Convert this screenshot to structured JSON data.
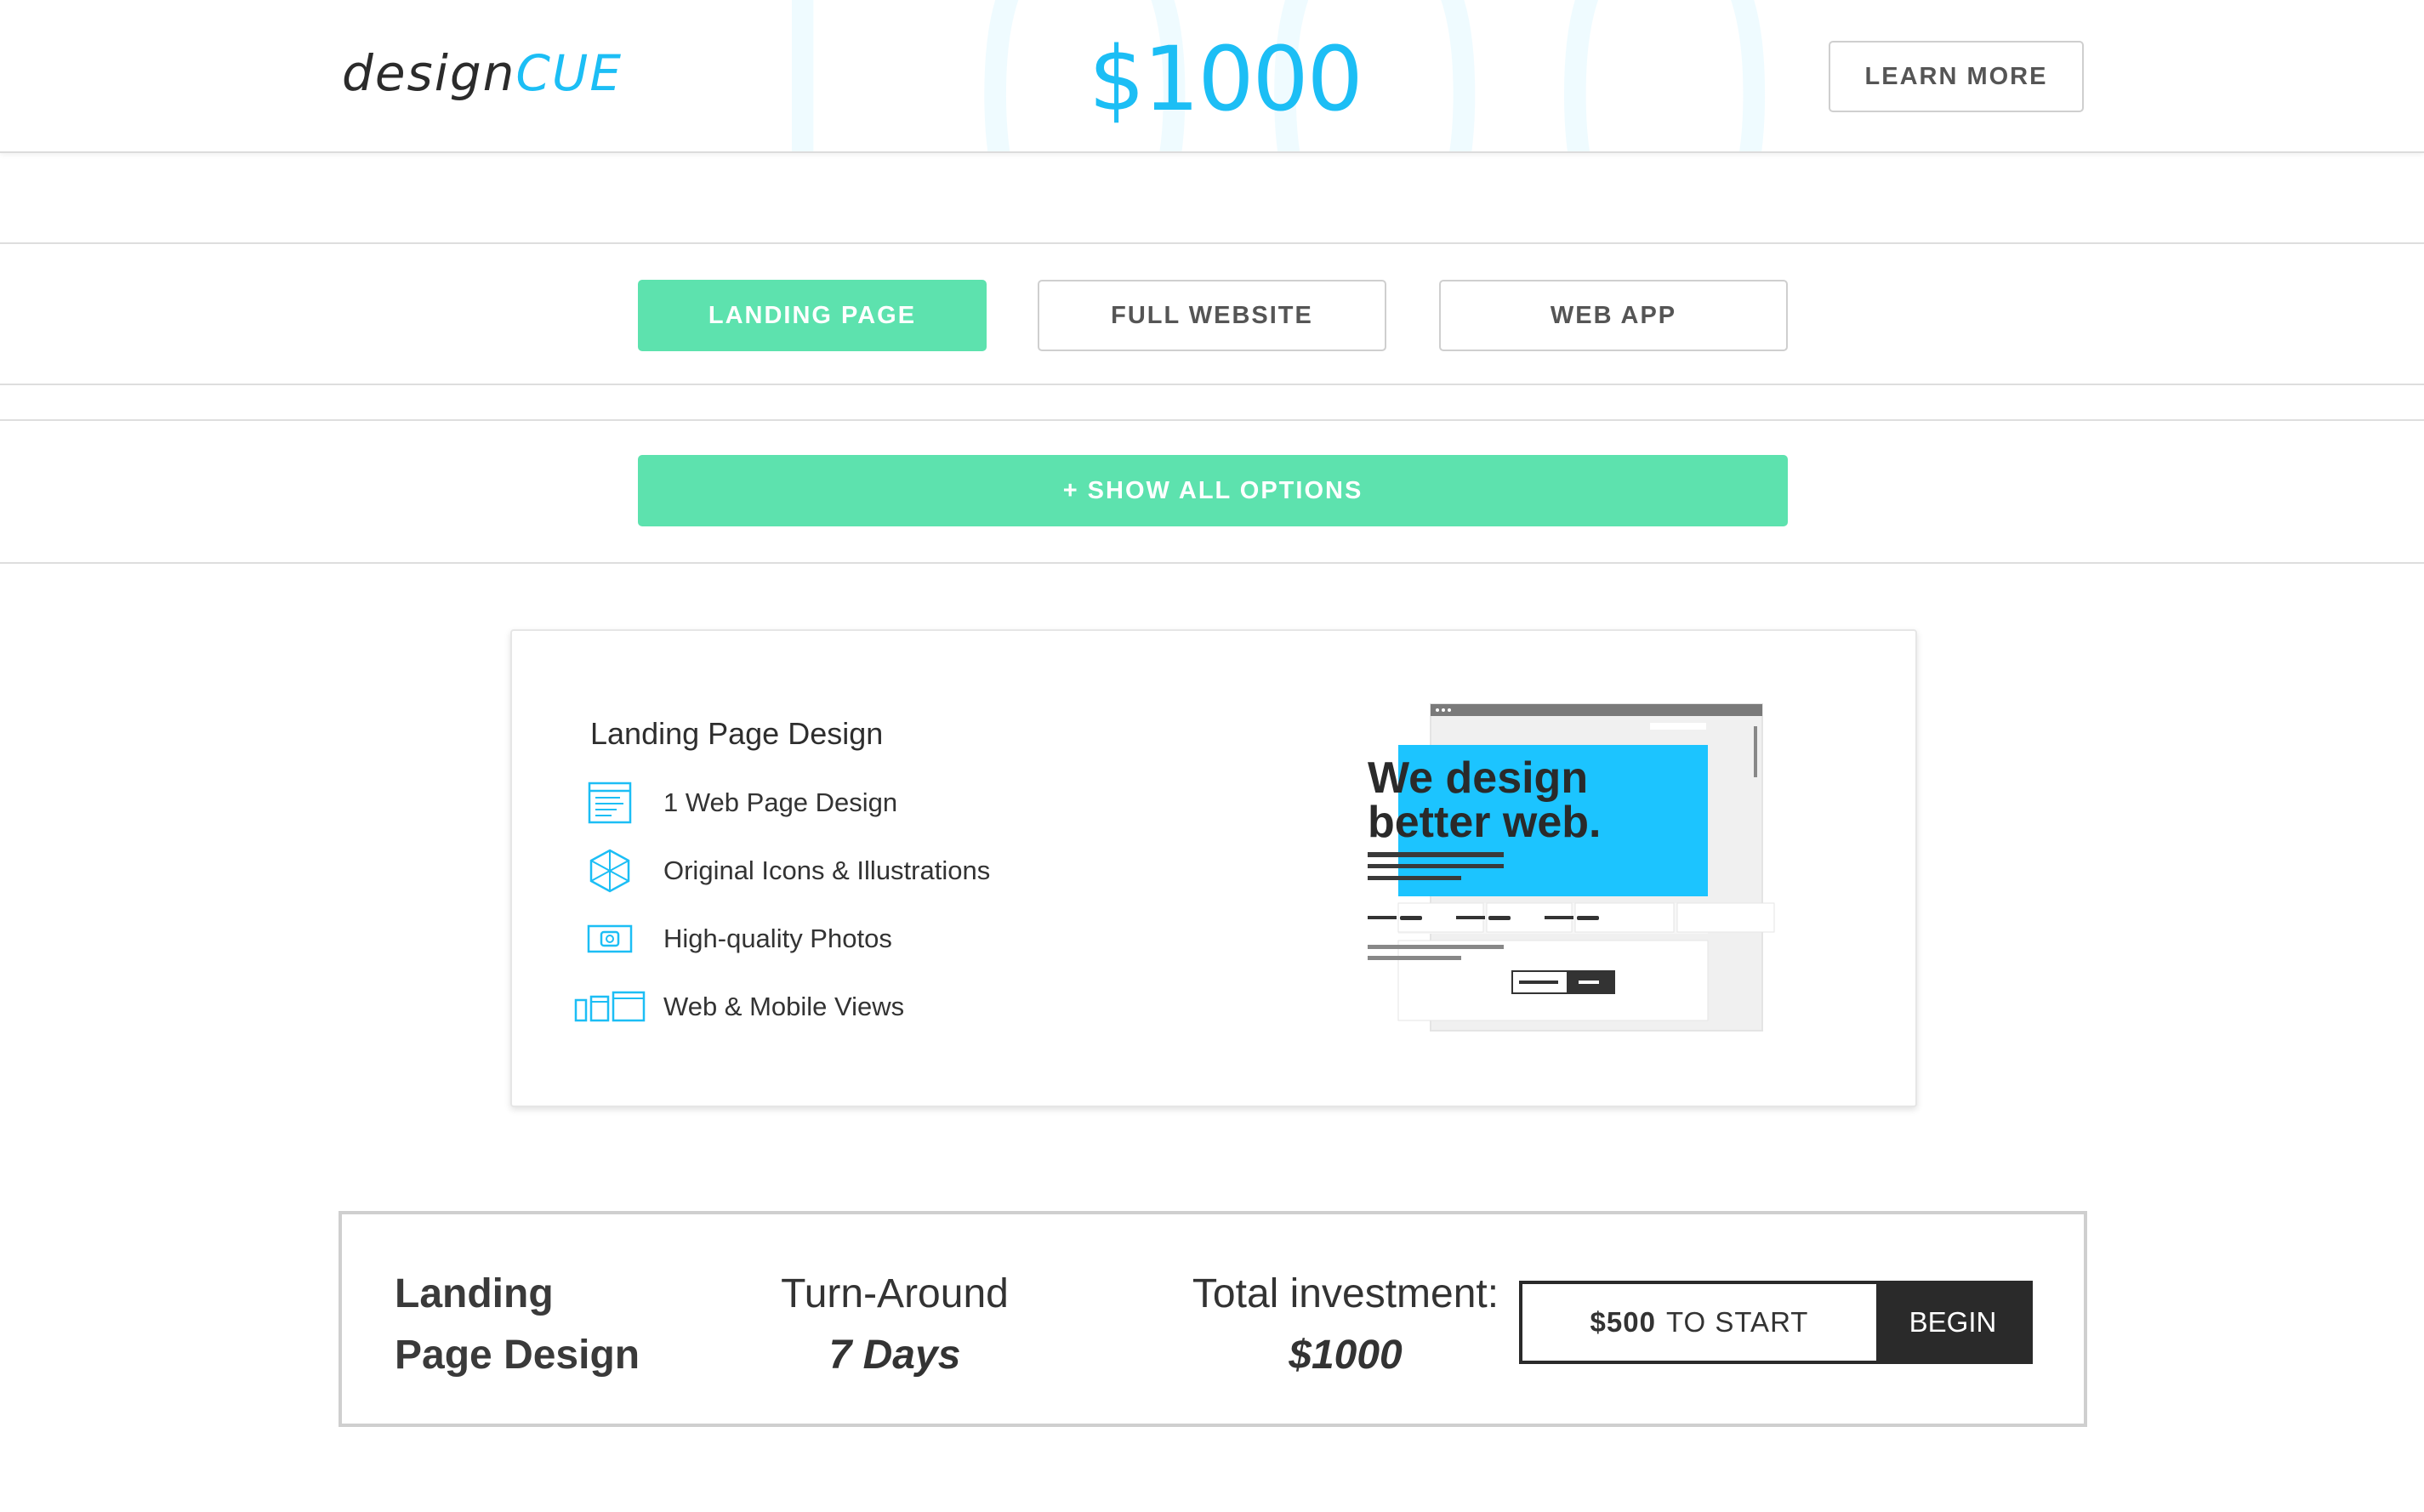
{
  "header": {
    "logo_part1": "design",
    "logo_part2": "CUE",
    "bg_number": "1000",
    "price": "$1000",
    "learn_more": "LEARN MORE"
  },
  "tabs": [
    {
      "label": "LANDING PAGE",
      "active": true
    },
    {
      "label": "FULL WEBSITE",
      "active": false
    },
    {
      "label": "WEB APP",
      "active": false
    }
  ],
  "show_all": "+ SHOW ALL OPTIONS",
  "card": {
    "title": "Landing Page Design",
    "features": [
      {
        "icon": "web-page-icon",
        "label": "1 Web Page Design"
      },
      {
        "icon": "cube-icon",
        "label": "Original Icons & Illustrations"
      },
      {
        "icon": "photo-icon",
        "label": "High-quality Photos"
      },
      {
        "icon": "devices-icon",
        "label": "Web & Mobile Views"
      }
    ],
    "illustration_text_line1": "We design",
    "illustration_text_line2": "better web."
  },
  "summary": {
    "name_line1": "Landing",
    "name_line2": "Page Design",
    "turnaround_label": "Turn-Around",
    "turnaround_value": "7 Days",
    "total_label": "Total investment:",
    "total_value": "$1000",
    "cta_amount": "$500",
    "cta_text": "TO START",
    "begin": "BEGIN"
  },
  "colors": {
    "accent_blue": "#1cbef5",
    "accent_green": "#5de2ae",
    "dark": "#2a2a2a"
  }
}
